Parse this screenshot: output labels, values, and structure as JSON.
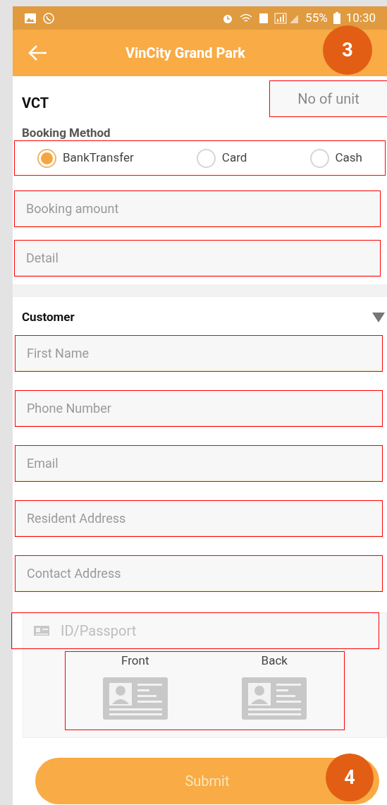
{
  "status_bar": {
    "battery": "55%",
    "time": "10:30"
  },
  "app_bar": {
    "title": "VinCity Grand Park",
    "callout": "3"
  },
  "project": {
    "code": "VCT",
    "unit_field": {
      "placeholder": "No of unit",
      "highlighted": true
    }
  },
  "booking_method": {
    "label": "Booking Method",
    "highlighted": true,
    "options": [
      {
        "label": "BankTransfer",
        "selected": true
      },
      {
        "label": "Card",
        "selected": false
      },
      {
        "label": "Cash",
        "selected": false
      }
    ]
  },
  "booking_fields": [
    {
      "placeholder": "Booking amount",
      "highlighted": true
    },
    {
      "placeholder": "Detail",
      "highlighted": true
    }
  ],
  "customer": {
    "title": "Customer",
    "expanded": true,
    "fields": [
      {
        "placeholder": "First Name",
        "highlighted": true
      },
      {
        "placeholder": "Phone Number",
        "highlighted": true
      },
      {
        "placeholder": "Email",
        "highlighted": true
      },
      {
        "placeholder": "Resident Address",
        "highlighted": true
      },
      {
        "placeholder": "Contact Address",
        "highlighted": true
      }
    ]
  },
  "id_section": {
    "placeholder": "ID/Passport",
    "highlighted": true,
    "photos_highlighted": true,
    "sides": [
      {
        "label": "Front"
      },
      {
        "label": "Back"
      }
    ]
  },
  "submit": {
    "label": "Submit",
    "callout": "4"
  }
}
